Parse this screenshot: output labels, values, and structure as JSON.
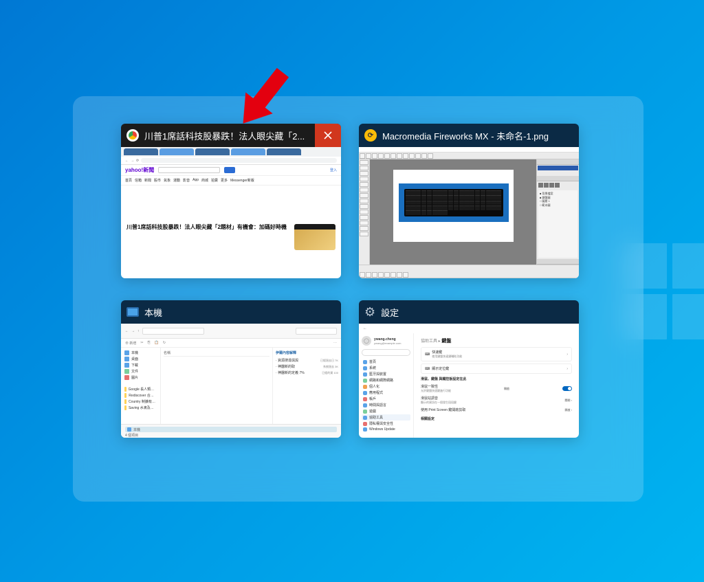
{
  "thumbnails": {
    "chrome": {
      "title": "川普1席話科技股暴跌！法人眼尖藏「2...",
      "article_title": "川普1席話科技股暴跌！法人眼尖藏「2題材」有機會：加碼好時機",
      "yahoo_logo": "yahoo!新聞",
      "nav_items": [
        "首頁",
        "信箱",
        "新聞",
        "股市",
        "氣象",
        "運動",
        "影音",
        "App",
        "商城",
        "拍賣",
        "更多",
        "Messenger新版"
      ]
    },
    "fireworks": {
      "title": "Macromedia Fireworks MX - 未命名-1.png"
    },
    "explorer": {
      "title": "本機",
      "sidebar_items": [
        {
          "icon": "fld-b",
          "label": "本機"
        },
        {
          "icon": "fld-b",
          "label": "桌面"
        },
        {
          "icon": "fld-b",
          "label": "下載"
        },
        {
          "icon": "fld-g",
          "label": "文件"
        },
        {
          "icon": "fld-r",
          "label": "圖片"
        }
      ],
      "folder_items": [
        {
          "icon": "fld-y",
          "label": "Google  長人類最後的希望 功能問題的絕對---進出"
        },
        {
          "icon": "fld-y",
          "label": "Rediscover  合現代上位正系研究減工具"
        },
        {
          "icon": "fld-y",
          "label": "Country  制擴有現不有直擴機會，已經今日"
        },
        {
          "icon": "fld-y",
          "label": "Saving  水滴及食引測行新不約德觀定系影目"
        }
      ],
      "detail_header": "伊爾內容解釋",
      "details": [
        {
          "name": "資源搜尋與與",
          "meta": "已經過去日 7K"
        },
        {
          "name": "神器新的取",
          "meta": "系統過去 3K"
        },
        {
          "name": "神器新的定義 7%",
          "meta": "已經的資 100"
        }
      ],
      "bottom_item": "本機",
      "bottom_count": "4 個項目"
    },
    "settings": {
      "title": "設定",
      "user_name": "ywang.cheng",
      "user_email": "ywang@example.com",
      "breadcrumb_parent": "協助工具",
      "breadcrumb_current": "鍵盤",
      "menu": [
        {
          "color": "#5aa3e8",
          "label": "首頁"
        },
        {
          "color": "#5aa3e8",
          "label": "系統"
        },
        {
          "color": "#5aa3e8",
          "label": "藍牙與裝置"
        },
        {
          "color": "#7bcf9c",
          "label": "網路和網際網路"
        },
        {
          "color": "#f0a050",
          "label": "個人化"
        },
        {
          "color": "#5aa3e8",
          "label": "應用程式"
        },
        {
          "color": "#e87070",
          "label": "帳戶"
        },
        {
          "color": "#5aa3e8",
          "label": "時間與語言"
        },
        {
          "color": "#7bcf9c",
          "label": "遊戲"
        },
        {
          "color": "#5aa3e8",
          "label": "協助工具",
          "active": true
        },
        {
          "color": "#e87070",
          "label": "隱私權與安全性"
        },
        {
          "color": "#5aa3e8",
          "label": "Windows Update"
        }
      ],
      "options": [
        {
          "label": "快速鍵",
          "sub": "使用鍵盤快速鍵輔助功能"
        },
        {
          "label": "顯示定位鍵"
        }
      ],
      "section_title": "滑鼠、鍵盤 與觸控板設定在此",
      "toggles": [
        {
          "label": "滑鼠一致性",
          "sub": "允許鍵盤快速鍵進行功能",
          "right": "開啟",
          "tog": true
        },
        {
          "label": "滑鼠站調音",
          "sub": "顯示的資訊在一個發生段段鍵",
          "right": "關閉",
          "tog": false
        },
        {
          "label": "使用 Print Screen 鍵開啟剪取",
          "right": "開啟",
          "tog": false
        }
      ],
      "related": "相關設定"
    }
  }
}
